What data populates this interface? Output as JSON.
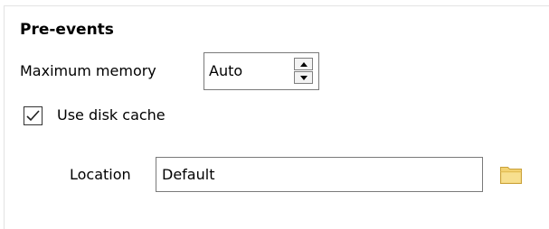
{
  "section": {
    "title": "Pre-events"
  },
  "memory": {
    "label": "Maximum memory",
    "value": "Auto",
    "icons": [
      "spin-up-icon",
      "spin-down-icon"
    ]
  },
  "disk_cache": {
    "label": "Use disk cache",
    "checked": true,
    "icon": "checkmark-icon"
  },
  "location": {
    "label": "Location",
    "value": "Default",
    "browse_icon": "folder-icon"
  },
  "colors": {
    "folder": "#f2d272",
    "folder_outline": "#c9a13a",
    "border": "#7a7a7a"
  }
}
